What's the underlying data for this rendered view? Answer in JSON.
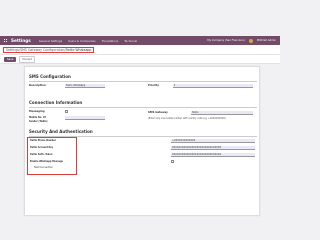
{
  "navbar": {
    "app_title": "Settings",
    "menu": [
      "General Settings",
      "Users & Companies",
      "Translations",
      "Technical"
    ],
    "company": "My Company (San Francisco)",
    "user": "Mitchell Admin"
  },
  "breadcrumb": {
    "items": [
      "Settings",
      "SMS Gateway Configuration"
    ],
    "current": "Twilio Whatsapp",
    "sep": " / "
  },
  "actions": {
    "save": "Save",
    "discard": "Discard"
  },
  "sms_config": {
    "title": "SMS Configuration",
    "description_label": "Description",
    "description_value": "Twilio Whatsapp",
    "priority_label": "Priority",
    "priority_value": "1"
  },
  "connection": {
    "title": "Connection Information",
    "messaging_label": "Messaging",
    "mobile_label": "Mobile No. Of",
    "mobile_label2": "Sender (Twilio)",
    "mobile_value": "",
    "gateway_label": "SMS Gateway",
    "gateway_value": "Twilio",
    "note": "(Enter only one mobile number with country code e.g. +XXXXXXXXXX)"
  },
  "security": {
    "title": "Security And Authentication",
    "phone_label": "Twilio Phone Number",
    "account_label": "Twilio Account Key",
    "token_label": "Twilio Auth. Token",
    "whatsapp_label": "Enable Whatsapp Message",
    "test_label": "Test Connection",
    "phone_value": "+XXXXXXXXXXXXX",
    "account_value": "XXXXXXXXXXXXXXXXXXXXXXXXXXXXXX",
    "token_value": "XXXXXXXXXXXXXXXXXXXXXXXXXXXXXX"
  },
  "colors": {
    "brand": "#714b67",
    "highlight": "#e03c3c",
    "field": "#e8e8f7"
  }
}
